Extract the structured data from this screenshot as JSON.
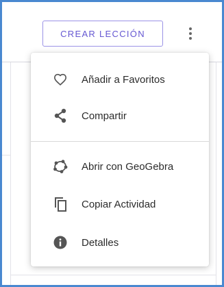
{
  "header": {
    "create_lesson_label": "CREAR LECCIÓN",
    "more_icon": "more-vert-icon"
  },
  "menu": {
    "items": [
      {
        "label": "Añadir a Favoritos",
        "icon": "heart-outline-icon"
      },
      {
        "label": "Compartir",
        "icon": "share-icon"
      },
      {
        "label": "Abrir con GeoGebra",
        "icon": "geogebra-icon"
      },
      {
        "label": "Copiar Actividad",
        "icon": "copy-icon"
      },
      {
        "label": "Detalles",
        "icon": "info-icon"
      }
    ]
  },
  "colors": {
    "accent": "#6557d2",
    "accent_border": "#9a92e6",
    "frame_border": "#4a88d0",
    "icon": "#555555",
    "text": "#2b2b2b"
  }
}
